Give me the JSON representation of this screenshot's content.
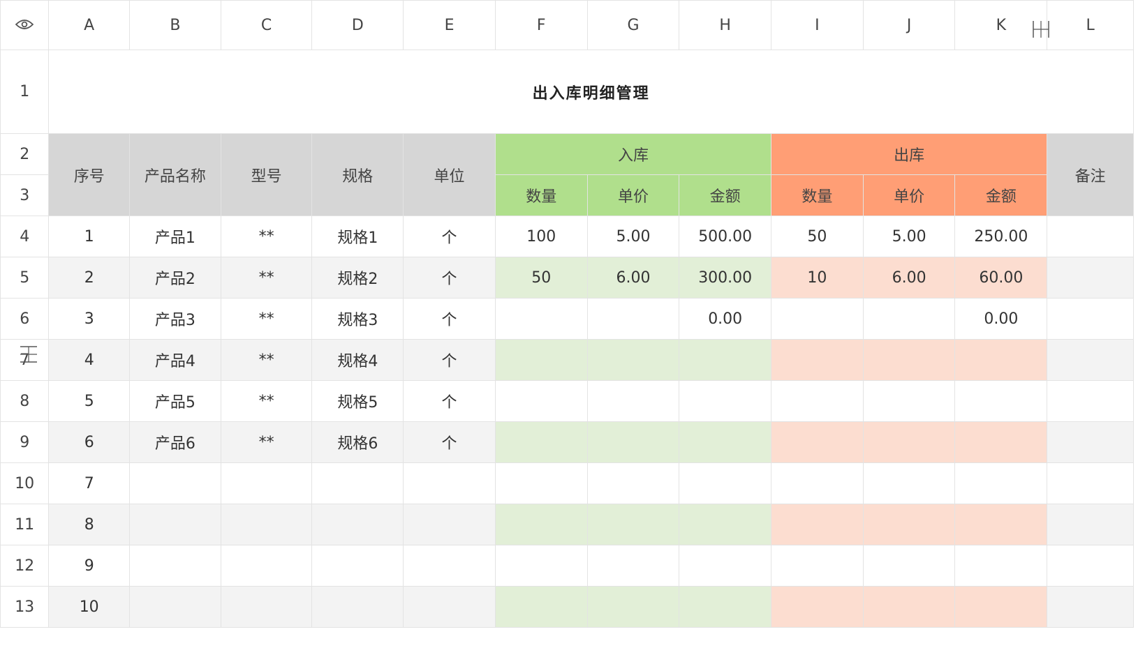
{
  "column_headers": [
    "A",
    "B",
    "C",
    "D",
    "E",
    "F",
    "G",
    "H",
    "I",
    "J",
    "K",
    "L"
  ],
  "title": "出入库明细管理",
  "header": {
    "seq": "序号",
    "name": "产品名称",
    "model": "型号",
    "spec": "规格",
    "unit": "单位",
    "inbound": "入库",
    "outbound": "出库",
    "remark": "备注",
    "qty": "数量",
    "price": "单价",
    "amount": "金额"
  },
  "row_numbers": [
    "1",
    "2",
    "3",
    "4",
    "5",
    "6",
    "7",
    "8",
    "9",
    "10",
    "11",
    "12",
    "13"
  ],
  "rows": [
    {
      "seq": "1",
      "name": "产品1",
      "model": "**",
      "spec": "规格1",
      "unit": "个",
      "in_qty": "100",
      "in_price": "5.00",
      "in_amount": "500.00",
      "out_qty": "50",
      "out_price": "5.00",
      "out_amount": "250.00",
      "remark": ""
    },
    {
      "seq": "2",
      "name": "产品2",
      "model": "**",
      "spec": "规格2",
      "unit": "个",
      "in_qty": "50",
      "in_price": "6.00",
      "in_amount": "300.00",
      "out_qty": "10",
      "out_price": "6.00",
      "out_amount": "60.00",
      "remark": ""
    },
    {
      "seq": "3",
      "name": "产品3",
      "model": "**",
      "spec": "规格3",
      "unit": "个",
      "in_qty": "",
      "in_price": "",
      "in_amount": "0.00",
      "out_qty": "",
      "out_price": "",
      "out_amount": "0.00",
      "remark": ""
    },
    {
      "seq": "4",
      "name": "产品4",
      "model": "**",
      "spec": "规格4",
      "unit": "个",
      "in_qty": "",
      "in_price": "",
      "in_amount": "",
      "out_qty": "",
      "out_price": "",
      "out_amount": "",
      "remark": ""
    },
    {
      "seq": "5",
      "name": "产品5",
      "model": "**",
      "spec": "规格5",
      "unit": "个",
      "in_qty": "",
      "in_price": "",
      "in_amount": "",
      "out_qty": "",
      "out_price": "",
      "out_amount": "",
      "remark": ""
    },
    {
      "seq": "6",
      "name": "产品6",
      "model": "**",
      "spec": "规格6",
      "unit": "个",
      "in_qty": "",
      "in_price": "",
      "in_amount": "",
      "out_qty": "",
      "out_price": "",
      "out_amount": "",
      "remark": ""
    },
    {
      "seq": "7",
      "name": "",
      "model": "",
      "spec": "",
      "unit": "",
      "in_qty": "",
      "in_price": "",
      "in_amount": "",
      "out_qty": "",
      "out_price": "",
      "out_amount": "",
      "remark": ""
    },
    {
      "seq": "8",
      "name": "",
      "model": "",
      "spec": "",
      "unit": "",
      "in_qty": "",
      "in_price": "",
      "in_amount": "",
      "out_qty": "",
      "out_price": "",
      "out_amount": "",
      "remark": ""
    },
    {
      "seq": "9",
      "name": "",
      "model": "",
      "spec": "",
      "unit": "",
      "in_qty": "",
      "in_price": "",
      "in_amount": "",
      "out_qty": "",
      "out_price": "",
      "out_amount": "",
      "remark": ""
    },
    {
      "seq": "10",
      "name": "",
      "model": "",
      "spec": "",
      "unit": "",
      "in_qty": "",
      "in_price": "",
      "in_amount": "",
      "out_qty": "",
      "out_price": "",
      "out_amount": "",
      "remark": ""
    }
  ],
  "colors": {
    "header_gray": "#d6d6d6",
    "inbound_header": "#b0df8c",
    "outbound_header": "#ff9e75",
    "inbound_band": "#e2efd7",
    "outbound_band": "#fcddd0",
    "gray_band": "#f3f3f3"
  },
  "icons": {
    "corner": "eye-icon",
    "cursor_col": "column-resize-cursor-icon",
    "cursor_row": "row-resize-cursor-icon"
  }
}
